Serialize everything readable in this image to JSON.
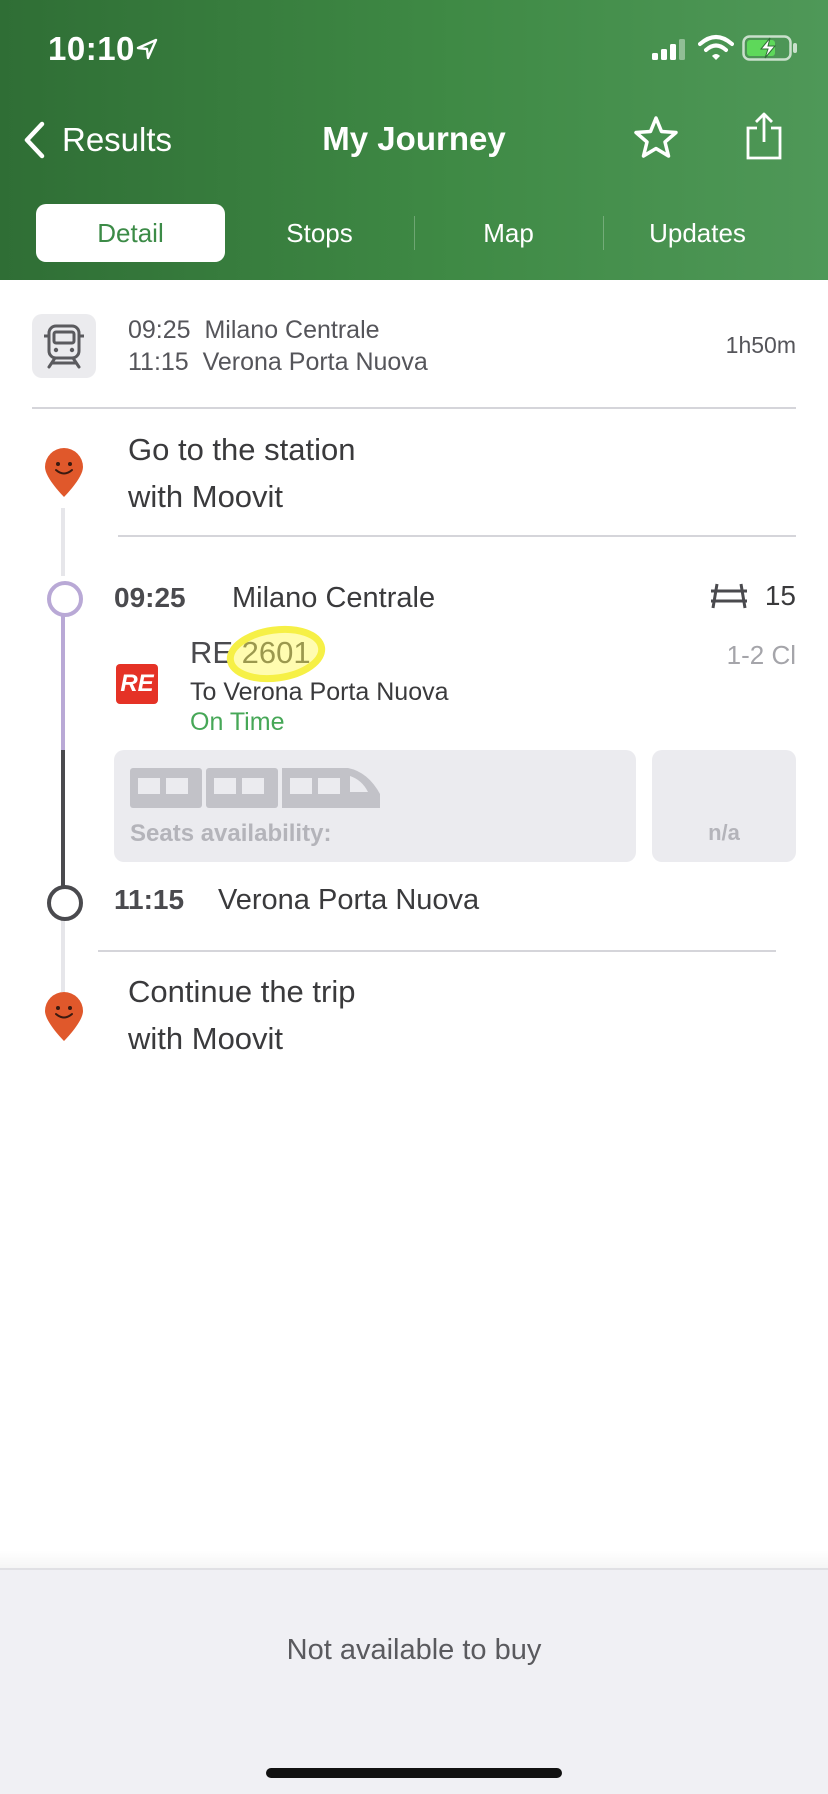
{
  "status_bar": {
    "time": "10:10"
  },
  "nav": {
    "back_label": "Results",
    "title": "My Journey"
  },
  "tabs": [
    {
      "label": "Detail",
      "active": true
    },
    {
      "label": "Stops",
      "active": false
    },
    {
      "label": "Map",
      "active": false
    },
    {
      "label": "Updates",
      "active": false
    }
  ],
  "summary": {
    "departure": "09:25  Milano Centrale",
    "arrival": "11:15  Verona Porta Nuova",
    "duration": "1h50m"
  },
  "steps": {
    "start_line1": "Go to the station",
    "start_line2": "with Moovit",
    "end_line1": "Continue the trip",
    "end_line2": "with Moovit"
  },
  "departure_stop": {
    "time": "09:25",
    "name": "Milano Centrale",
    "platform": "15"
  },
  "train": {
    "badge": "RE",
    "number": "RE 2601",
    "class": "1-2 Cl",
    "direction": "To Verona Porta Nuova",
    "status": "On Time"
  },
  "seats": {
    "label": "Seats availability:",
    "value": "n/a"
  },
  "arrival_stop": {
    "time": "11:15",
    "name": "Verona Porta Nuova"
  },
  "bottom": {
    "message": "Not available to buy"
  },
  "colors": {
    "header_green": "#3f8a45",
    "active_tab_text": "#3c8b47",
    "on_time": "#46a757",
    "moovit_pin": "#e0582b",
    "re_badge": "#e53226",
    "timeline_purple": "#b9a9d6"
  }
}
